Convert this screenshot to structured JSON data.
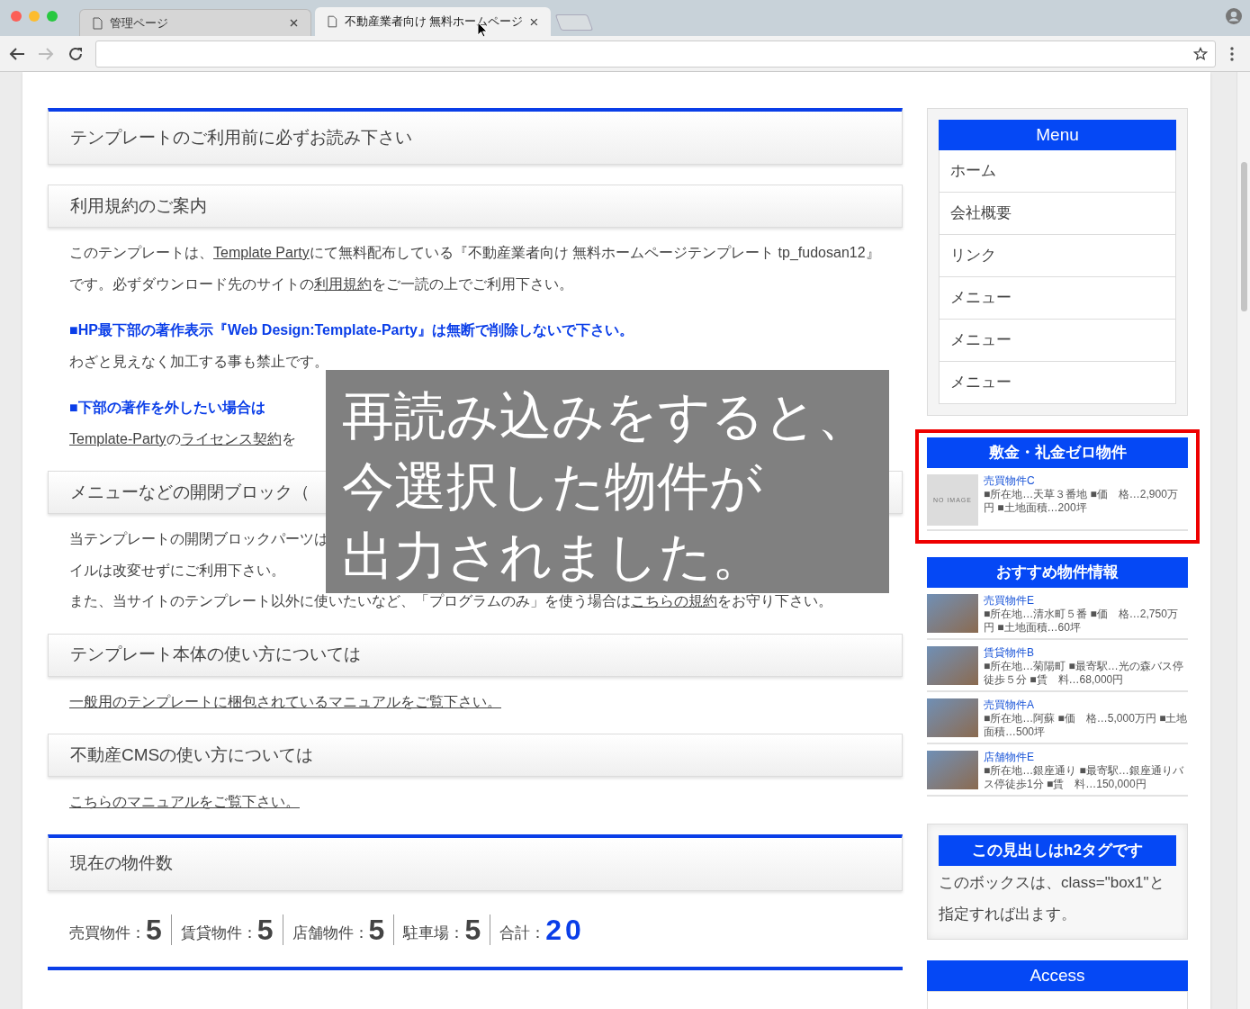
{
  "browser": {
    "tabs": [
      {
        "title": "管理ページ",
        "selected": false
      },
      {
        "title": "不動産業者向け 無料ホームページ",
        "selected": true
      }
    ]
  },
  "main": {
    "blocks": [
      {
        "kind": "heading",
        "accent": true,
        "text": "テンプレートのご利用前に必ずお読み下さい"
      },
      {
        "kind": "heading",
        "accent": false,
        "text": "利用規約のご案内"
      },
      {
        "kind": "paragraph",
        "segments": [
          {
            "text": "このテンプレートは、",
            "link": false
          },
          {
            "text": "Template Party",
            "link": true
          },
          {
            "text": "にて無料配布している『不動産業者向け 無料ホームページテンプレート tp_fudosan12』です。必ずダウンロード先のサイトの",
            "link": false
          },
          {
            "text": "利用規約",
            "link": true
          },
          {
            "text": "をご一読の上でご利用下さい。",
            "link": false
          }
        ]
      },
      {
        "kind": "notice",
        "text": "■HP最下部の著作表示『Web Design:Template-Party』は無断で削除しないで下さい。"
      },
      {
        "kind": "paragraph",
        "segments": [
          {
            "text": "わざと見えなく加工する事も禁止です。",
            "link": false
          }
        ]
      },
      {
        "kind": "notice",
        "text": "■下部の著作を外したい場合は"
      },
      {
        "kind": "paragraph",
        "segments": [
          {
            "text": "Template-Party",
            "link": true
          },
          {
            "text": "の",
            "link": false
          },
          {
            "text": "ライセンス契約",
            "link": true
          },
          {
            "text": "を",
            "link": false
          }
        ]
      },
      {
        "kind": "heading",
        "accent": false,
        "text": "メニューなどの開閉ブロック（"
      },
      {
        "kind": "paragraph",
        "segments": [
          {
            "text": "当テンプレートの開閉ブロックパーツは",
            "link": false
          }
        ]
      },
      {
        "kind": "paragraph",
        "segments": [
          {
            "text": "イルは改変せずにご利用下さい。",
            "link": false
          }
        ]
      },
      {
        "kind": "paragraph",
        "segments": [
          {
            "text": "また、当サイトのテンプレート以外に使いたいなど、「プログラムのみ」を使う場合は",
            "link": false
          },
          {
            "text": "こちらの規約",
            "link": true
          },
          {
            "text": "をお守り下さい。",
            "link": false
          }
        ]
      },
      {
        "kind": "heading",
        "accent": false,
        "text": "テンプレート本体の使い方については"
      },
      {
        "kind": "paragraph",
        "segments": [
          {
            "text": "一般用のテンプレートに梱包されているマニュアルをご覧下さい。",
            "link": true
          }
        ]
      },
      {
        "kind": "heading",
        "accent": false,
        "text": "不動産CMSの使い方については"
      },
      {
        "kind": "paragraph",
        "segments": [
          {
            "text": "こちらのマニュアルをご覧下さい。",
            "link": true
          }
        ]
      },
      {
        "kind": "heading",
        "accent": true,
        "text": "現在の物件数"
      },
      {
        "kind": "counts",
        "items": [
          {
            "label": "売買物件：",
            "value": "5",
            "total": false
          },
          {
            "label": "賃貸物件：",
            "value": "5",
            "total": false
          },
          {
            "label": "店舗物件：",
            "value": "5",
            "total": false
          },
          {
            "label": "駐車場：",
            "value": "5",
            "total": false
          },
          {
            "label": "合計：",
            "value": "20",
            "total": true
          }
        ]
      }
    ]
  },
  "sidebar": {
    "menu": {
      "title": "Menu",
      "items": [
        "ホーム",
        "会社概要",
        "リンク",
        "メニュー",
        "メニュー",
        "メニュー"
      ]
    },
    "listings": [
      {
        "title": "敷金・礼金ゼロ物件",
        "highlighted": true,
        "items": [
          {
            "kind": "no_image",
            "image_label": "NO IMAGE",
            "name": "売買物件C",
            "details": "■所在地…天草３番地 ■価　格…2,900万円 ■土地面積…200坪"
          }
        ]
      },
      {
        "title": "おすすめ物件情報",
        "highlighted": false,
        "items": [
          {
            "kind": "photo",
            "name": "売買物件E",
            "details": "■所在地…清水町５番 ■価　格…2,750万円 ■土地面積…60坪"
          },
          {
            "kind": "photo",
            "name": "賃貸物件B",
            "details": "■所在地…菊陽町 ■最寄駅…光の森バス停徒歩５分 ■賃　料…68,000円"
          },
          {
            "kind": "photo",
            "name": "売買物件A",
            "details": "■所在地…阿蘇 ■価　格…5,000万円 ■土地面積…500坪"
          },
          {
            "kind": "photo",
            "name": "店舗物件E",
            "details": "■所在地…銀座通り ■最寄駅…銀座通りバス停徒歩1分 ■賃　料…150,000円"
          }
        ]
      }
    ],
    "box": {
      "title": "この見出しはh2タグです",
      "text": "このボックスは、class=\"box1\"と指定すれば出ます。"
    },
    "access": {
      "title": "Access"
    }
  },
  "caption": {
    "lines": [
      "再読み込みをすると、",
      "今選択した物件が",
      "出力されました。"
    ]
  }
}
